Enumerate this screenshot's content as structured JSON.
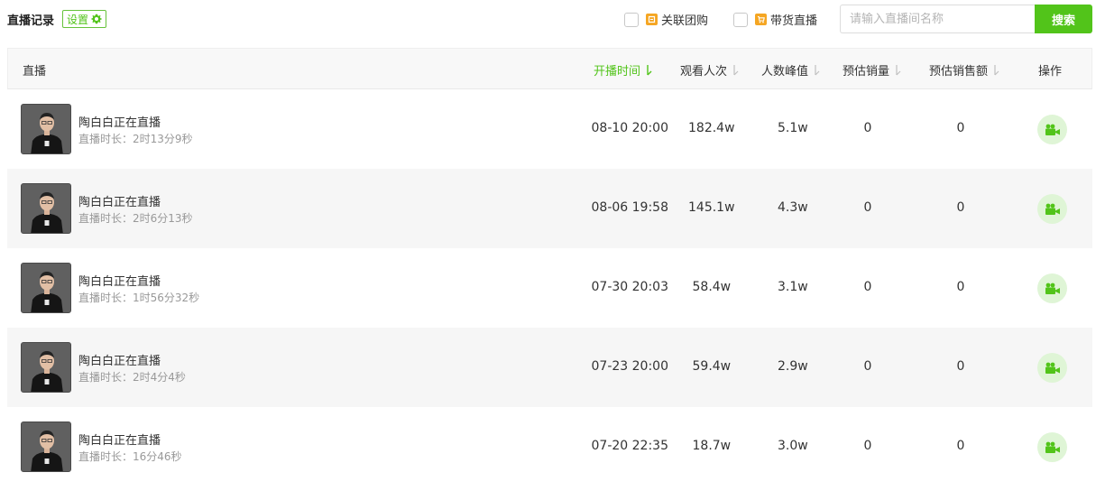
{
  "header": {
    "title": "直播记录",
    "settings_label": "设置"
  },
  "filters": [
    {
      "label": "关联团购",
      "checked": false,
      "icon": "group-buy-icon",
      "color": "#f5a623"
    },
    {
      "label": "带货直播",
      "checked": false,
      "icon": "shopping-cart-icon",
      "color": "#f5a623"
    }
  ],
  "search": {
    "placeholder": "请输入直播间名称",
    "button_label": "搜索"
  },
  "colors": {
    "accent": "#52c41a",
    "accent_light": "#dff5d6"
  },
  "table": {
    "columns": {
      "live": "直播",
      "start_time": "开播时间",
      "views": "观看人次",
      "peak": "人数峰值",
      "est_sales": "预估销量",
      "est_revenue": "预估销售额",
      "actions": "操作"
    },
    "active_sort": "start_time",
    "rows": [
      {
        "name": "陶白白正在直播",
        "duration": "直播时长：2时13分9秒",
        "start_time": "08-10 20:00",
        "views": "182.4w",
        "peak": "5.1w",
        "est_sales": "0",
        "est_revenue": "0",
        "action_icon": "video-camera-icon"
      },
      {
        "name": "陶白白正在直播",
        "duration": "直播时长：2时6分13秒",
        "start_time": "08-06 19:58",
        "views": "145.1w",
        "peak": "4.3w",
        "est_sales": "0",
        "est_revenue": "0",
        "action_icon": "video-camera-icon"
      },
      {
        "name": "陶白白正在直播",
        "duration": "直播时长：1时56分32秒",
        "start_time": "07-30 20:03",
        "views": "58.4w",
        "peak": "3.1w",
        "est_sales": "0",
        "est_revenue": "0",
        "action_icon": "video-camera-icon"
      },
      {
        "name": "陶白白正在直播",
        "duration": "直播时长：2时4分4秒",
        "start_time": "07-23 20:00",
        "views": "59.4w",
        "peak": "2.9w",
        "est_sales": "0",
        "est_revenue": "0",
        "action_icon": "video-camera-icon"
      },
      {
        "name": "陶白白正在直播",
        "duration": "直播时长：16分46秒",
        "start_time": "07-20 22:35",
        "views": "18.7w",
        "peak": "3.0w",
        "est_sales": "0",
        "est_revenue": "0",
        "action_icon": "video-camera-icon"
      }
    ]
  }
}
